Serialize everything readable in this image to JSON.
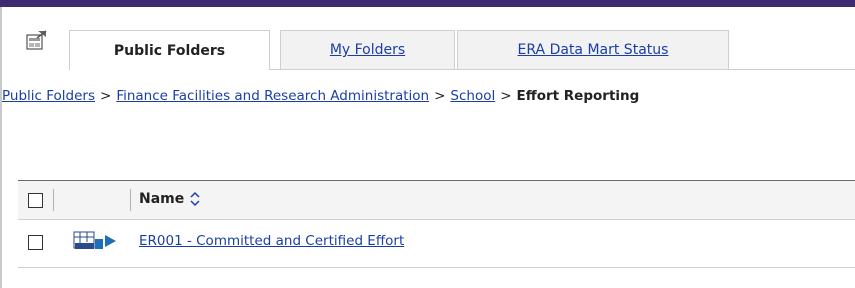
{
  "tabs": {
    "home_icon": "home-portal-icon",
    "items": [
      {
        "label": "Public Folders",
        "active": true
      },
      {
        "label": "My Folders",
        "active": false
      },
      {
        "label": "ERA Data Mart Status",
        "active": false
      }
    ]
  },
  "breadcrumb": {
    "items": [
      "Public Folders",
      "Finance Facilities and Research Administration",
      "School"
    ],
    "separator": ">",
    "current": "Effort Reporting"
  },
  "list": {
    "columns": {
      "name": "Name"
    },
    "sort_icon": "sort-up-down-icon",
    "rows": [
      {
        "name": "ER001 - Committed and Certified Effort",
        "icon": "html-report-run-icon"
      }
    ]
  },
  "colors": {
    "top_bar": "#3e2a6e",
    "link": "#1a3ea8"
  }
}
